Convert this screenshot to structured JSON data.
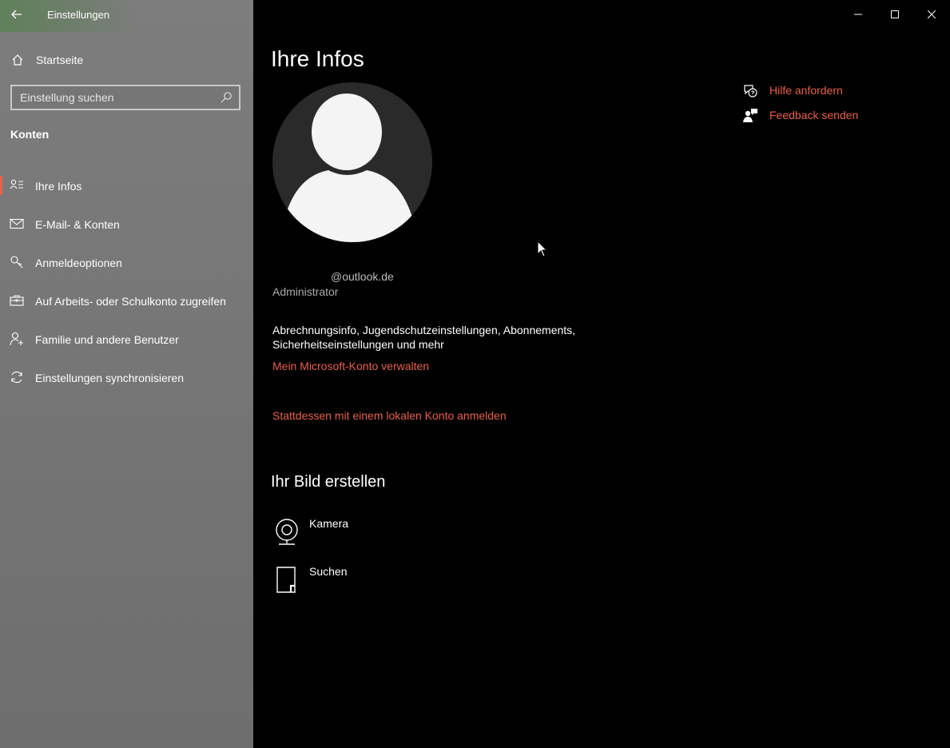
{
  "window": {
    "title": "Einstellungen",
    "accent_color": "#e8604a"
  },
  "sidebar": {
    "back_icon": "back-arrow-icon",
    "home_label": "Startseite",
    "search": {
      "placeholder": "Einstellung suchen"
    },
    "section_title": "Konten",
    "items": [
      {
        "label": "Ihre Infos",
        "icon": "person-info-icon",
        "active": true
      },
      {
        "label": "E-Mail- & Konten",
        "icon": "mail-icon",
        "active": false
      },
      {
        "label": "Anmeldeoptionen",
        "icon": "key-icon",
        "active": false
      },
      {
        "label": "Auf Arbeits- oder Schulkonto zugreifen",
        "icon": "briefcase-icon",
        "active": false
      },
      {
        "label": "Familie und andere Benutzer",
        "icon": "person-add-icon",
        "active": false
      },
      {
        "label": "Einstellungen synchronisieren",
        "icon": "sync-icon",
        "active": false
      }
    ]
  },
  "main": {
    "title": "Ihre Infos",
    "email": "@outlook.de",
    "role": "Administrator",
    "description": "Abrechnungsinfo, Jugendschutzeinstellungen, Abonnements, Sicherheitseinstellungen und mehr",
    "manage_link": "Mein Microsoft-Konto verwalten",
    "local_link": "Stattdessen mit einem lokalen Konto anmelden",
    "picture_section_title": "Ihr Bild erstellen",
    "picture_options": [
      {
        "label": "Kamera",
        "icon": "camera-icon"
      },
      {
        "label": "Suchen",
        "icon": "file-browse-icon"
      }
    ],
    "help": [
      {
        "label": "Hilfe anfordern",
        "icon": "help-chat-icon"
      },
      {
        "label": "Feedback senden",
        "icon": "feedback-icon"
      }
    ]
  }
}
